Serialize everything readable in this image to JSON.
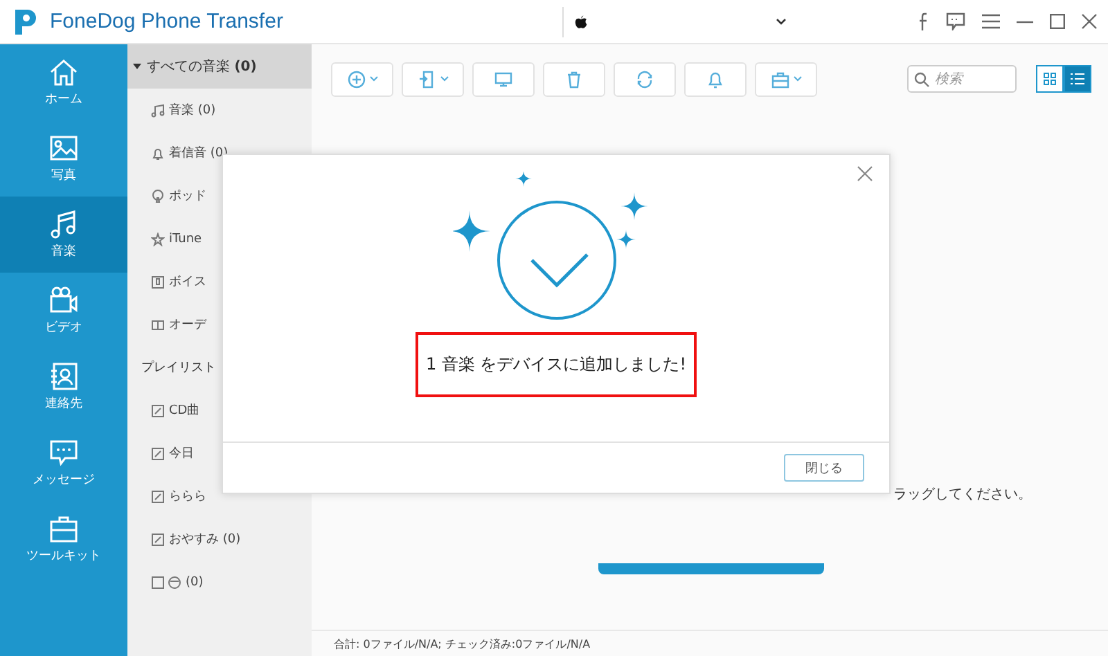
{
  "window": {
    "title": "FoneDog Phone Transfer"
  },
  "nav": [
    {
      "label": "ホーム",
      "selected": false
    },
    {
      "label": "写真",
      "selected": false
    },
    {
      "label": "音楽",
      "selected": true
    },
    {
      "label": "ビデオ",
      "selected": false
    },
    {
      "label": "連絡先",
      "selected": false
    },
    {
      "label": "メッセージ",
      "selected": false
    },
    {
      "label": "ツールキット",
      "selected": false
    }
  ],
  "categories": {
    "header": {
      "label": "すべての音楽",
      "count": "(0)",
      "expanded": true
    },
    "items": [
      "音楽 (0)",
      "着信音 (0)",
      "ポッド",
      "iTune",
      "ボイス",
      "オーデ"
    ],
    "playlist_header": "プレイリスト",
    "playlists": [
      "CD曲",
      "今日",
      "ららら",
      "おやすみ (0)",
      "(0)"
    ]
  },
  "toolbar": {
    "search": {
      "placeholder": "検索"
    },
    "views": [
      {
        "selected": false
      },
      {
        "selected": true
      }
    ]
  },
  "background_hint": "ラッグしてください。",
  "status_bar": "合計: 0ファイル/N/A; チェック済み:0ファイル/N/A",
  "dialog": {
    "message": "1 音楽 をデバイスに追加しました!",
    "button": "閉じる"
  }
}
